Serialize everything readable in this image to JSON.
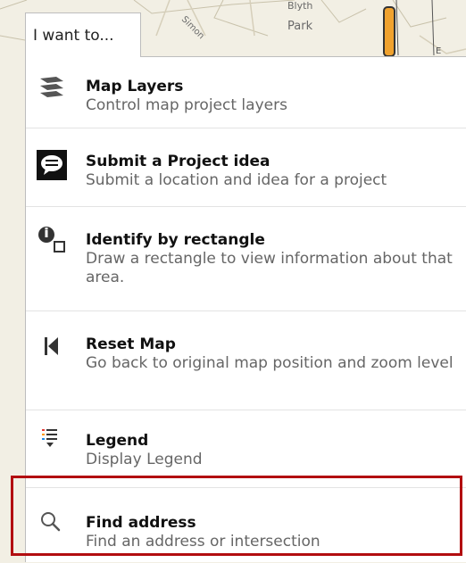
{
  "tab": {
    "label": "I want to..."
  },
  "map": {
    "park_label": "Park",
    "park_label_top": "Blyth",
    "street_label": "Simon"
  },
  "menu": {
    "items": [
      {
        "id": "map-layers",
        "icon": "layers-icon",
        "title": "Map Layers",
        "desc": "Control map project layers"
      },
      {
        "id": "submit-project-idea",
        "icon": "speech-bubble-icon",
        "title": "Submit a Project idea",
        "desc": "Submit a location and idea for a project"
      },
      {
        "id": "identify-by-rectangle",
        "icon": "identify-rectangle-icon",
        "title": "Identify by rectangle",
        "desc": "Draw a rectangle to view information about that area."
      },
      {
        "id": "reset-map",
        "icon": "skip-back-icon",
        "title": "Reset Map",
        "desc": "Go back to original map position and zoom level"
      },
      {
        "id": "legend",
        "icon": "legend-list-icon",
        "title": "Legend",
        "desc": "Display Legend"
      },
      {
        "id": "find-address",
        "icon": "search-icon",
        "title": "Find address",
        "desc": "Find an address or intersection"
      }
    ]
  },
  "colors": {
    "highlight": "#b20d10",
    "route": "#f0a22e"
  }
}
